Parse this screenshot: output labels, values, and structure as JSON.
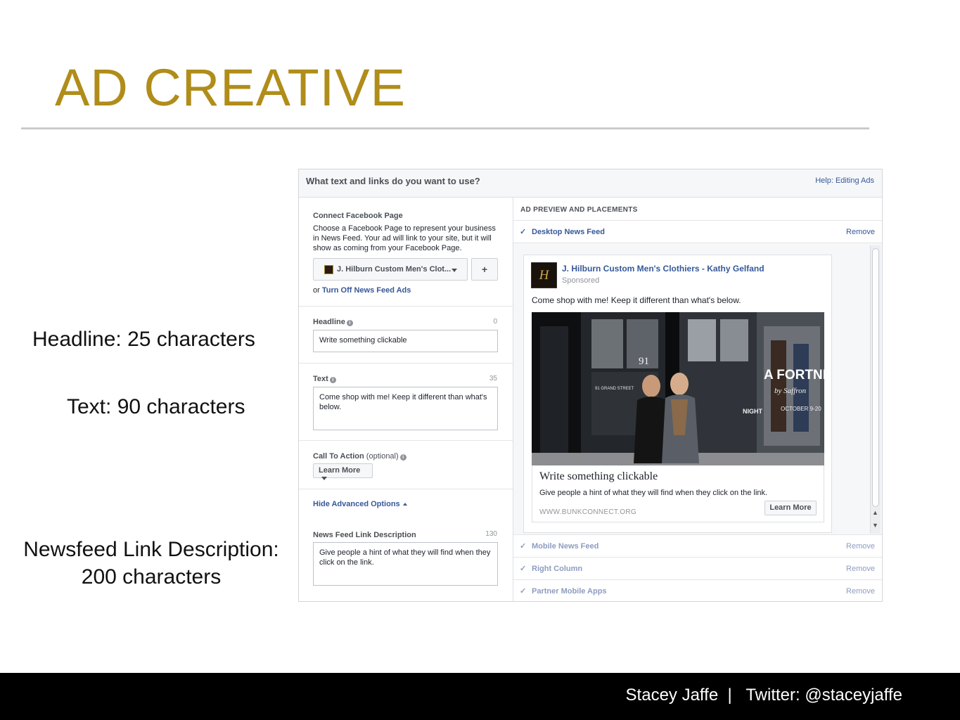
{
  "slide": {
    "title": "AD CREATIVE",
    "annotations": {
      "headline": "Headline: 25 characters",
      "text": "Text: 90 characters",
      "newsfeed_line1": "Newsfeed Link Description:",
      "newsfeed_line2": "200 characters"
    },
    "footer": "Stacey Jaffe  |   Twitter: @staceyjaffe"
  },
  "panel": {
    "title": "What text and links do you want to use?",
    "help_link": "Help: Editing Ads",
    "connect_page": {
      "label": "Connect Facebook Page",
      "description": "Choose a Facebook Page to represent your business in News Feed. Your ad will link to your site, but it will show as coming from your Facebook Page.",
      "selected_page": "J. Hilburn Custom Men's Clot...",
      "add_button": "+",
      "turn_off_prefix": "or ",
      "turn_off_link": "Turn Off News Feed Ads"
    },
    "headline": {
      "label": "Headline",
      "count": "0",
      "placeholder": "Write something clickable"
    },
    "text": {
      "label": "Text",
      "count": "35",
      "value": "Come shop with me! Keep it different than what's below."
    },
    "call_to_action": {
      "label": "Call To Action",
      "optional": "(optional)",
      "selected": "Learn More"
    },
    "advanced_toggle": "Hide Advanced Options",
    "link_description": {
      "label": "News Feed Link Description",
      "count": "130",
      "value": "Give people a hint of what they will find when they click on the link."
    },
    "preview": {
      "title": "AD PREVIEW AND PLACEMENTS",
      "placements": [
        {
          "label": "Desktop News Feed",
          "remove": "Remove"
        },
        {
          "label": "Mobile News Feed",
          "remove": "Remove"
        },
        {
          "label": "Right Column",
          "remove": "Remove"
        },
        {
          "label": "Partner Mobile Apps",
          "remove": "Remove"
        }
      ],
      "ad": {
        "avatar_letter": "H",
        "page_name": "J. Hilburn Custom Men's Clothiers - Kathy Gelfand",
        "sponsored": "Sponsored",
        "body": "Come shop with me! Keep it different than what's below.",
        "headline": "Write something clickable",
        "description": "Give people a hint of what they will find when they click on the link.",
        "domain": "WWW.BUNKCONNECT.ORG",
        "cta": "Learn More",
        "image_text": {
          "address": "91",
          "store": "A FORTNIG",
          "script": "by Saffron",
          "dates": "OCTOBER 9-20",
          "night": "NIGHT",
          "street": "91 GRAND STREET"
        }
      }
    }
  },
  "colors": {
    "title_gold": "#b08d1a",
    "fb_link_blue": "#365899",
    "footer_bg": "#000000"
  }
}
